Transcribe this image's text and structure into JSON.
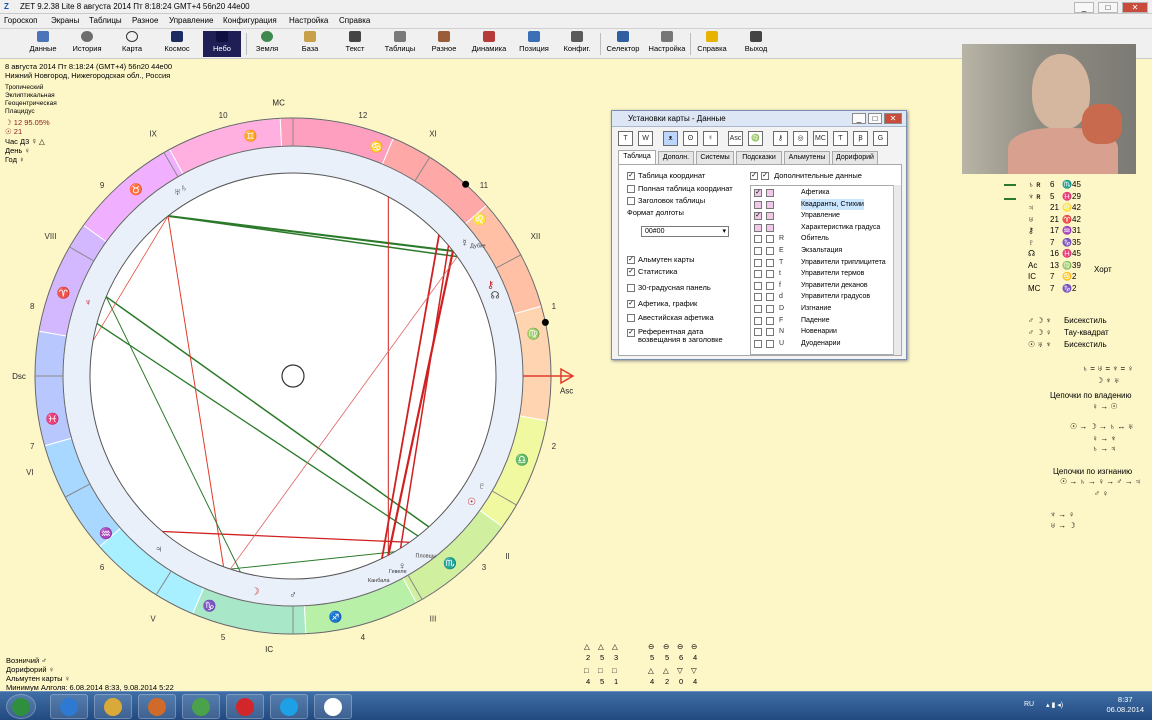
{
  "window": {
    "title": "ZET 9.2.38 Lite    8 августа 2014  Пт  8:18:24 GMT+4 56n20  44e00",
    "buttons": [
      "_",
      "□",
      "✕"
    ]
  },
  "menu": [
    "Гороскоп",
    "Экраны",
    "Таблицы",
    "Разное",
    "Управление",
    "Конфигурация",
    "Настройка",
    "Справка"
  ],
  "toolbar": [
    "Данные",
    "История",
    "Карта",
    "Космос",
    "Небо",
    "Земля",
    "База",
    "Текст",
    "Таблицы",
    "Разное",
    "Динамика",
    "Позиция",
    "Конфиг.",
    "Селектор",
    "Настройка",
    "Справка",
    "Выход"
  ],
  "header": {
    "date_line": "8 августа 2014  Пт   8:18:24 (GMT+4) 56n20  44e00",
    "place": "Нижний Новгород, Нижегородская обл., Россия",
    "settings": [
      "Тропический",
      "Эклиптикальная",
      "Геоцентрическая",
      "Плацидус"
    ],
    "moon_phase": "☽  12 95.05%",
    "sun_degree": "☉  21",
    "hour_line": "Час Д3  ☿  △",
    "day_line": "День  ♀",
    "year_line": "Год  ♀"
  },
  "wheel": {
    "angles": {
      "mc": "MC",
      "asc": "Asc",
      "dsc": "Dsc",
      "ic": "IC"
    },
    "house_roman": [
      "IX",
      "VIII",
      "VI",
      "V",
      "XI",
      "XII",
      "II",
      "III"
    ],
    "house_numbers": [
      "10",
      "9",
      "8",
      "7",
      "6",
      "5",
      "4",
      "3",
      "2",
      "1",
      "11",
      "12"
    ],
    "signs": [
      "♊",
      "♉",
      "♈",
      "♓",
      "♒",
      "♑",
      "♐",
      "♏",
      "♎",
      "♍",
      "♌",
      "♋"
    ],
    "planet_glyphs": [
      "♅",
      "♆",
      "♄",
      "♂",
      "☽",
      "♃",
      "♀",
      "☉",
      "♇",
      "☿",
      "⚷",
      "☊"
    ],
    "fixed_stars": [
      "Дубхе",
      "Гевеле",
      "Канбала",
      "Пловцы"
    ],
    "zone_colors": [
      "#ffd4b0",
      "#ffc0a6",
      "#ffa8a8",
      "#ff9fbf",
      "#ffb0e0",
      "#f0b0ff",
      "#d4b8ff",
      "#b8c8ff",
      "#a8d8ff",
      "#a8f0ff",
      "#a8e8c8",
      "#b8f0a8",
      "#d0f0a0",
      "#f0f8a0"
    ]
  },
  "bottom_left": {
    "lines": [
      "Возничий  ♂",
      "Дорифорий  ♀",
      "Альмутен карты  ♀",
      "Минимум Алголя: 6.08.2014  8:33,  9.08.2014  5:22"
    ]
  },
  "bottom_stats": {
    "glyphs": [
      "△",
      "△",
      "△",
      "⊖",
      "⊖",
      "⊖",
      "⊖",
      "□",
      "□",
      "□",
      "△",
      "△",
      "▽",
      "▽"
    ],
    "values": [
      "2",
      "5",
      "3",
      "5",
      "5",
      "6",
      "4",
      "4",
      "5",
      "1",
      "4",
      "2",
      "0",
      "4"
    ]
  },
  "dialog": {
    "title": "Установки карты - Данные",
    "icon_buttons": [
      "T",
      "W",
      "ᴥ",
      "ʘ",
      "☿",
      "Asc",
      "♍",
      "⚷",
      "◎",
      "MC",
      "Ƭ",
      "Ꞵ",
      "G"
    ],
    "tabs": [
      "Таблица",
      "Дополн.",
      "Системы",
      "Подсказки",
      "Альмутены",
      "Дорифорий"
    ],
    "options": [
      {
        "label": "Таблица координат",
        "checked": true
      },
      {
        "label": "Полная таблица координат",
        "checked": false
      },
      {
        "label": "Заголовок таблицы",
        "checked": false
      },
      {
        "label": "Формат долготы",
        "checked": false
      },
      {
        "label": "Альмутен карты",
        "checked": true
      },
      {
        "label": "Статистика",
        "checked": true
      },
      {
        "label": "30-градусная панель",
        "checked": false
      },
      {
        "label": "Афетика, график",
        "checked": true
      },
      {
        "label": "Авестийская афетика",
        "checked": false
      },
      {
        "label": "Референтная дата возвещания в заголовке",
        "checked": true
      }
    ],
    "longitude_format": "00#00",
    "extra_header": "Дополнительные данные",
    "extra_list": [
      {
        "abbr": "",
        "label": "Афетика",
        "c1": true,
        "c2": false
      },
      {
        "abbr": "",
        "label": "Квадранты, Стихии",
        "c1": false,
        "c2": false
      },
      {
        "abbr": "",
        "label": "Управление",
        "c1": true,
        "c2": false
      },
      {
        "abbr": "",
        "label": "Характеристика градуса",
        "c1": false,
        "c2": false
      },
      {
        "abbr": "R",
        "label": "Обитель",
        "c1": false,
        "c2": false
      },
      {
        "abbr": "E",
        "label": "Экзальтация",
        "c1": false,
        "c2": false
      },
      {
        "abbr": "T",
        "label": "Управители триплицитета",
        "c1": false,
        "c2": false
      },
      {
        "abbr": "t",
        "label": "Управители термов",
        "c1": false,
        "c2": false
      },
      {
        "abbr": "f",
        "label": "Управители деканов",
        "c1": false,
        "c2": false
      },
      {
        "abbr": "d",
        "label": "Управители градусов",
        "c1": false,
        "c2": false
      },
      {
        "abbr": "D",
        "label": "Изгнание",
        "c1": false,
        "c2": false
      },
      {
        "abbr": "F",
        "label": "Падение",
        "c1": false,
        "c2": false
      },
      {
        "abbr": "N",
        "label": "Новенарии",
        "c1": false,
        "c2": false
      },
      {
        "abbr": "U",
        "label": "Дуоденарии",
        "c1": false,
        "c2": false
      }
    ]
  },
  "right_panel": {
    "rows": [
      {
        "p": "♄ ʀ",
        "deg": "6",
        "sign": "♏",
        "min": "45"
      },
      {
        "p": "♆ ʀ",
        "deg": "5",
        "sign": "♓",
        "min": "29"
      },
      {
        "p": "♃",
        "deg": "21",
        "sign": "♌",
        "min": "42"
      },
      {
        "p": "♅",
        "deg": "21",
        "sign": "♈",
        "min": "42"
      },
      {
        "p": "⚷",
        "deg": "17",
        "sign": "♒",
        "min": "31"
      },
      {
        "p": "♇",
        "deg": "7",
        "sign": "♑",
        "min": "35"
      },
      {
        "p": "☊",
        "deg": "16",
        "sign": "♓",
        "min": "45"
      },
      {
        "p": "Ас",
        "deg": "13",
        "sign": "♍",
        "min": "39"
      },
      {
        "p": "IC",
        "deg": "7",
        "sign": "♋",
        "min": "2"
      },
      {
        "p": "MC",
        "deg": "7",
        "sign": "♑",
        "min": "2"
      }
    ],
    "hort_label": "Хорт",
    "aspects": [
      {
        "glyphs": "♂ ☽ ♆",
        "label": "Бисекстиль"
      },
      {
        "glyphs": "♂ ☽ ♀",
        "label": "Тау-квадрат"
      },
      {
        "glyphs": "☉ ♅ ♆",
        "label": "Бисекстиль"
      }
    ],
    "chain_top": "♄ = ♅ = ♆ = ♀",
    "chain_sub": "☽ ♆ ♅",
    "chain_title_ownership": "Цепочки по владению",
    "chain_title_exile": "Цепочки по изгнанию",
    "chain_own_lines": [
      "♀ → ☉",
      "☉ → ☽ → ♄ ↔ ♅",
      "♀ → ♆",
      "♄ → ♃"
    ],
    "chain_exile_lines": [
      "☉ → ♄ → ♀ → ♂ → ♃",
      "♂ ♀",
      "♆ → ♀",
      "♅ → ☽"
    ]
  },
  "taskbar": {
    "lang": "RU",
    "time": "8:37",
    "date": "06.08.2014",
    "apps": [
      "start",
      "ie",
      "explorer",
      "media",
      "chrome",
      "opera",
      "skype",
      "zet"
    ]
  }
}
